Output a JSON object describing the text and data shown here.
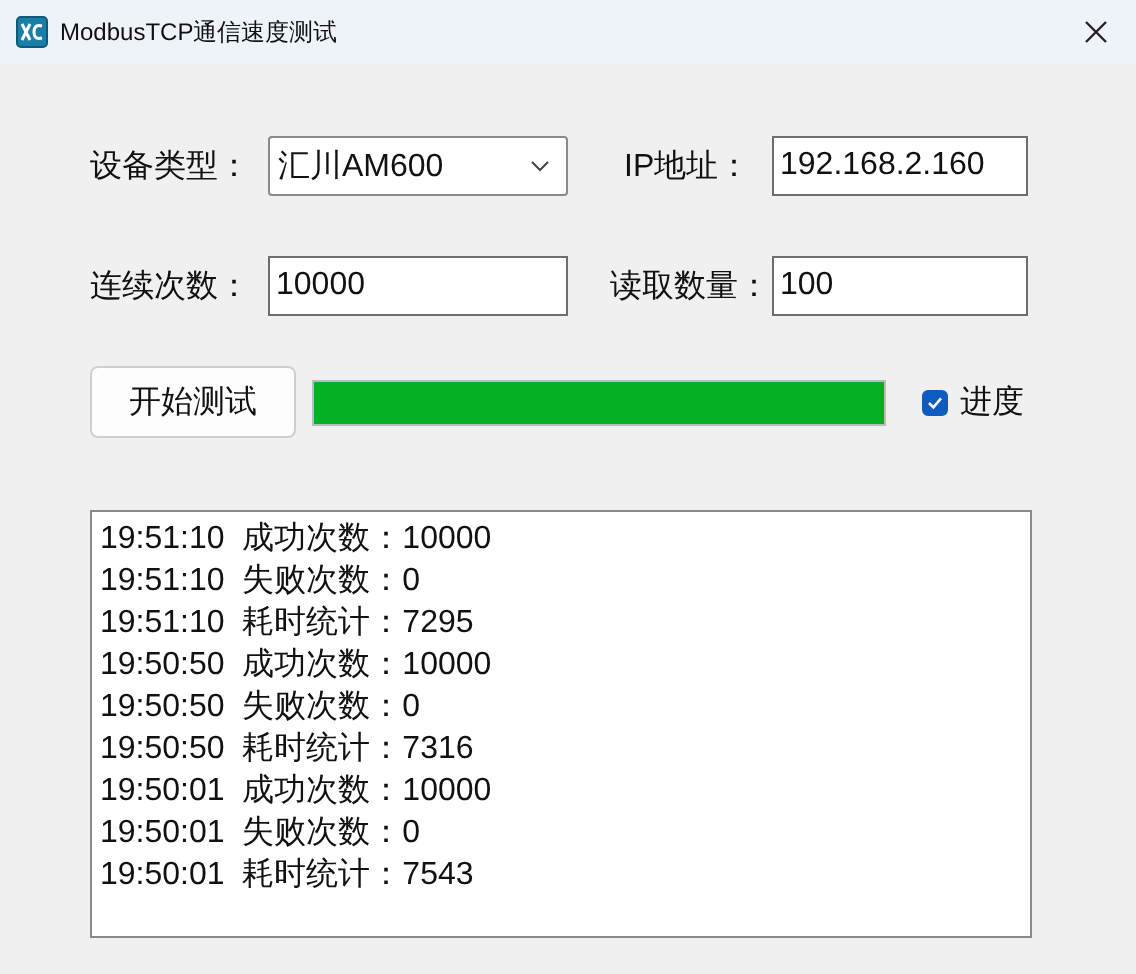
{
  "window": {
    "title": "ModbusTCP通信速度测试"
  },
  "device_type": {
    "label": "设备类型：",
    "value": "汇川AM600"
  },
  "ip_address": {
    "label": "IP地址：",
    "value": "192.168.2.160"
  },
  "repeat_count": {
    "label": "连续次数：",
    "value": "10000"
  },
  "read_count": {
    "label": "读取数量：",
    "value": "100"
  },
  "start_button": {
    "label": "开始测试"
  },
  "progress": {
    "level": 1.0
  },
  "progress_checkbox": {
    "label": "进度",
    "checked": true
  },
  "log": [
    {
      "time": "19:51:10",
      "text": "成功次数：10000"
    },
    {
      "time": "19:51:10",
      "text": "失败次数：0"
    },
    {
      "time": "19:51:10",
      "text": "耗时统计：7295"
    },
    {
      "time": "19:50:50",
      "text": "成功次数：10000"
    },
    {
      "time": "19:50:50",
      "text": "失败次数：0"
    },
    {
      "time": "19:50:50",
      "text": "耗时统计：7316"
    },
    {
      "time": "19:50:01",
      "text": "成功次数：10000"
    },
    {
      "time": "19:50:01",
      "text": "失败次数：0"
    },
    {
      "time": "19:50:01",
      "text": "耗时统计：7543"
    }
  ]
}
